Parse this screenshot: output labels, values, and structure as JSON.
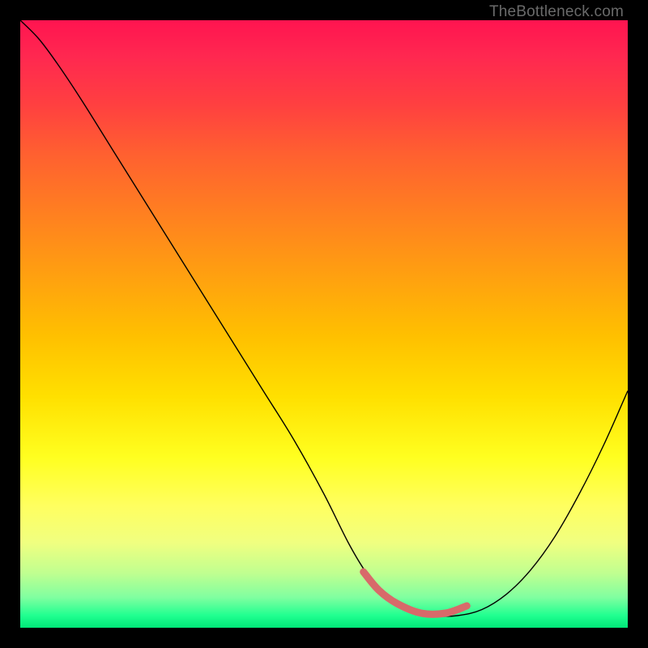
{
  "watermark": "TheBottleneck.com",
  "chart_data": {
    "type": "line",
    "title": "",
    "xlabel": "",
    "ylabel": "",
    "xlim": [
      0,
      1
    ],
    "ylim": [
      0,
      1
    ],
    "series": [
      {
        "name": "curve",
        "x": [
          0.0,
          0.03,
          0.06,
          0.1,
          0.15,
          0.2,
          0.25,
          0.3,
          0.35,
          0.4,
          0.45,
          0.5,
          0.54,
          0.57,
          0.6,
          0.64,
          0.68,
          0.72,
          0.76,
          0.8,
          0.84,
          0.88,
          0.92,
          0.96,
          1.0
        ],
        "y": [
          1.0,
          0.97,
          0.93,
          0.87,
          0.79,
          0.71,
          0.63,
          0.55,
          0.47,
          0.39,
          0.31,
          0.22,
          0.14,
          0.09,
          0.055,
          0.03,
          0.02,
          0.02,
          0.03,
          0.055,
          0.095,
          0.15,
          0.22,
          0.3,
          0.39
        ],
        "color": "#000000"
      },
      {
        "name": "highlight",
        "x": [
          0.565,
          0.59,
          0.62,
          0.66,
          0.7,
          0.735
        ],
        "y": [
          0.092,
          0.062,
          0.04,
          0.024,
          0.024,
          0.036
        ],
        "color": "#d86a6a"
      }
    ],
    "background_gradient": {
      "top": "#ff1450",
      "mid": "#ffe000",
      "bottom": "#00e878"
    }
  }
}
